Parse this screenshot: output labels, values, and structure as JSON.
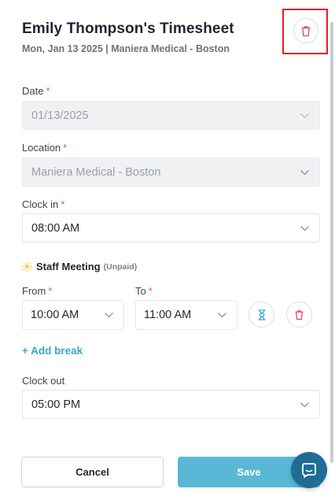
{
  "header": {
    "title": "Emily Thompson's Timesheet",
    "subtitle": "Mon, Jan 13 2025 | Maniera Medical - Boston"
  },
  "form": {
    "date": {
      "label": "Date",
      "required_mark": "*",
      "value": "01/13/2025"
    },
    "location": {
      "label": "Location",
      "required_mark": "*",
      "value": "Maniera Medical - Boston"
    },
    "clock_in": {
      "label": "Clock in",
      "required_mark": "*",
      "value": "08:00 AM"
    },
    "break": {
      "name": "Staff Meeting",
      "type": "(Unpaid)",
      "from": {
        "label": "From",
        "required_mark": "*",
        "value": "10:00 AM"
      },
      "to": {
        "label": "To",
        "required_mark": "*",
        "value": "11:00 AM"
      }
    },
    "add_break_label": "+ Add break",
    "clock_out": {
      "label": "Clock out",
      "required_mark": "*",
      "value": "05:00 PM"
    }
  },
  "actions": {
    "cancel_label": "Cancel",
    "save_label": "Save"
  },
  "icons": {
    "delete": "trash-icon",
    "break_type": "sun-icon",
    "duration": "hourglass-icon",
    "remove_break": "trash-icon",
    "chat": "chat-icon",
    "dropdown": "chevron-down-icon"
  },
  "colors": {
    "accent": "#58b8d6",
    "link": "#3aa6c9",
    "danger": "#e05561",
    "highlight": "#e11d2a",
    "chat": "#1f6d95"
  }
}
